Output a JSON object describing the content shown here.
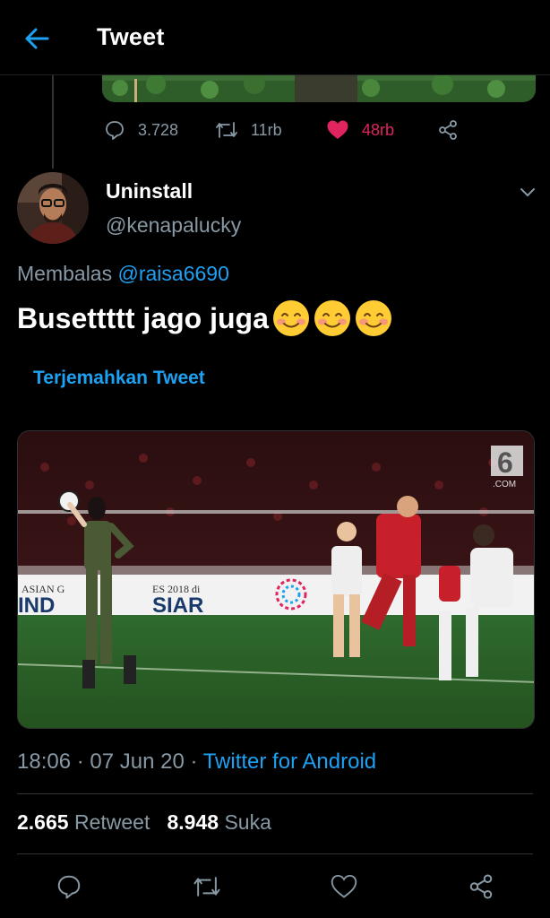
{
  "header": {
    "title": "Tweet",
    "back_icon": "arrow-left-icon",
    "accent": "#1da1f2"
  },
  "previous_tweet": {
    "replies": "3.728",
    "retweets": "11rb",
    "likes": "48rb",
    "like_color": "#e0245e"
  },
  "tweet": {
    "author_name": "Uninstall",
    "author_handle": "@kenapalucky",
    "reply_prefix": "Membalas",
    "reply_mention": "@raisa6690",
    "text": "Busettttt jago juga",
    "emoji": [
      "smiling-blush-emoji",
      "smiling-blush-emoji",
      "smiling-blush-emoji"
    ],
    "translate_label": "Terjemahkan Tweet",
    "media": {
      "watermark_number": "6",
      "watermark_text": ".COM",
      "banner_left": "ASIAN G",
      "banner_mid": "ES 2018 di",
      "banner_big_left": "IND",
      "banner_big_right": "SIAR"
    },
    "timestamp": "18:06 · 07 Jun 20 · ",
    "source": "Twitter for Android",
    "retweet_count": "2.665",
    "retweet_label": "Retweet",
    "like_count": "8.948",
    "like_label": "Suka"
  },
  "colors": {
    "background": "#000000",
    "muted": "#8899a6",
    "divider": "#2f3336"
  }
}
